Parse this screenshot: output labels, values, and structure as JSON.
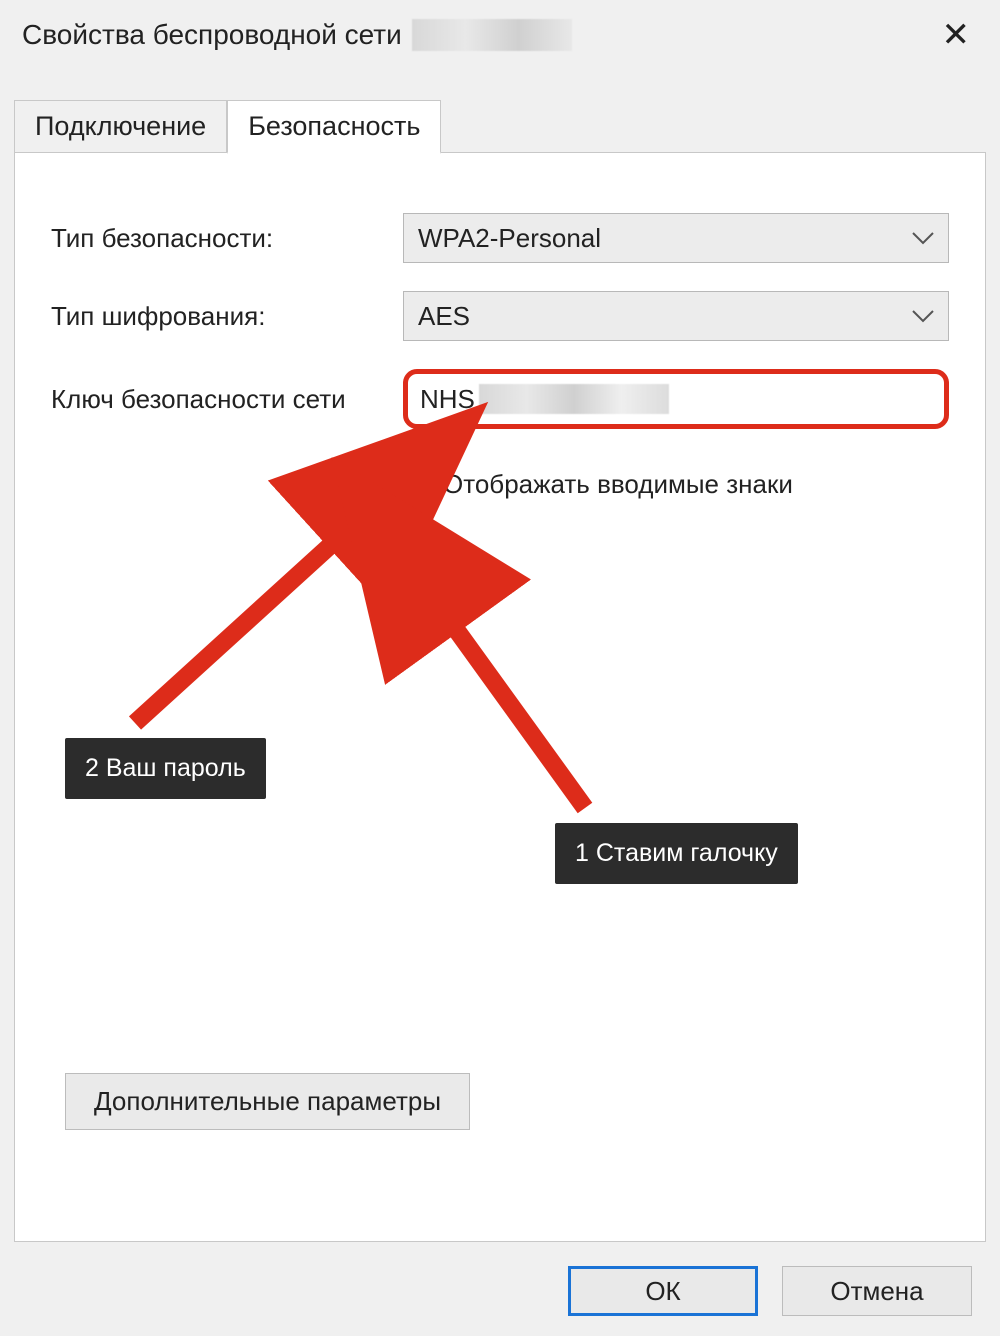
{
  "title": {
    "text": "Свойства беспроводной сети"
  },
  "tabs": {
    "connection": "Подключение",
    "security": "Безопасность"
  },
  "form": {
    "security_type_label": "Тип безопасности:",
    "security_type_value": "WPA2-Personal",
    "encryption_type_label": "Тип шифрования:",
    "encryption_type_value": "AES",
    "security_key_label": "Ключ безопасности сети",
    "security_key_value": "NHS",
    "show_chars_label": "Отображать вводимые знаки"
  },
  "advanced_btn": "Дополнительные параметры",
  "buttons": {
    "ok": "ОК",
    "cancel": "Отмена"
  },
  "callouts": {
    "step1": "1 Ставим галочку",
    "step2": "2 Ваш пароль"
  }
}
